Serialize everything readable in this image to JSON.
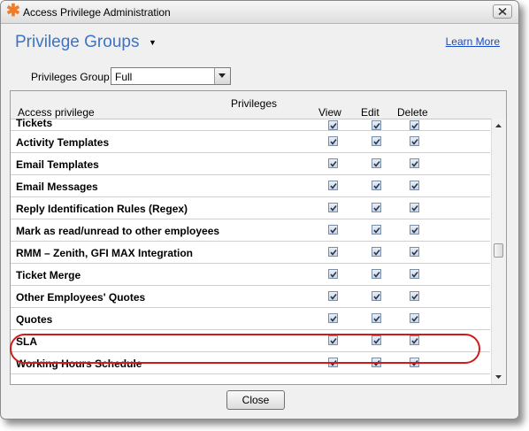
{
  "window": {
    "title": "Access Privilege Administration",
    "app_icon": "asterisk-icon",
    "close_icon": "close-icon"
  },
  "header": {
    "title": "Privilege Groups",
    "dropdown_icon": "caret-down-icon",
    "learn_more": "Learn More"
  },
  "privileges_group": {
    "label": "Privileges Group",
    "selected": "Full"
  },
  "table": {
    "headers": {
      "privileges": "Privileges",
      "access": "Access privilege",
      "view": "View",
      "edit": "Edit",
      "delete": "Delete"
    },
    "rows": [
      {
        "label": "Tickets",
        "view": true,
        "edit": true,
        "delete": true
      },
      {
        "label": "Activity Templates",
        "view": true,
        "edit": true,
        "delete": true
      },
      {
        "label": "Email Templates",
        "view": true,
        "edit": true,
        "delete": true
      },
      {
        "label": "Email Messages",
        "view": true,
        "edit": true,
        "delete": true
      },
      {
        "label": "Reply Identification Rules (Regex)",
        "view": true,
        "edit": true,
        "delete": true
      },
      {
        "label": "Mark as read/unread to other employees",
        "view": true,
        "edit": true,
        "delete": true
      },
      {
        "label": "RMM – Zenith, GFI MAX Integration",
        "view": true,
        "edit": true,
        "delete": true
      },
      {
        "label": "Ticket Merge",
        "view": true,
        "edit": true,
        "delete": true
      },
      {
        "label": "Other Employees' Quotes",
        "view": true,
        "edit": true,
        "delete": true
      },
      {
        "label": "Quotes",
        "view": true,
        "edit": true,
        "delete": true
      },
      {
        "label": "SLA",
        "view": true,
        "edit": true,
        "delete": true
      },
      {
        "label": "Working Hours Schedule",
        "view": true,
        "edit": true,
        "delete": true
      }
    ]
  },
  "colors": {
    "title_blue": "#3d73c5",
    "link_blue": "#1a4bc4",
    "highlight_red": "#d21a1a",
    "app_icon_orange": "#f07c2a"
  },
  "footer": {
    "close_label": "Close"
  }
}
